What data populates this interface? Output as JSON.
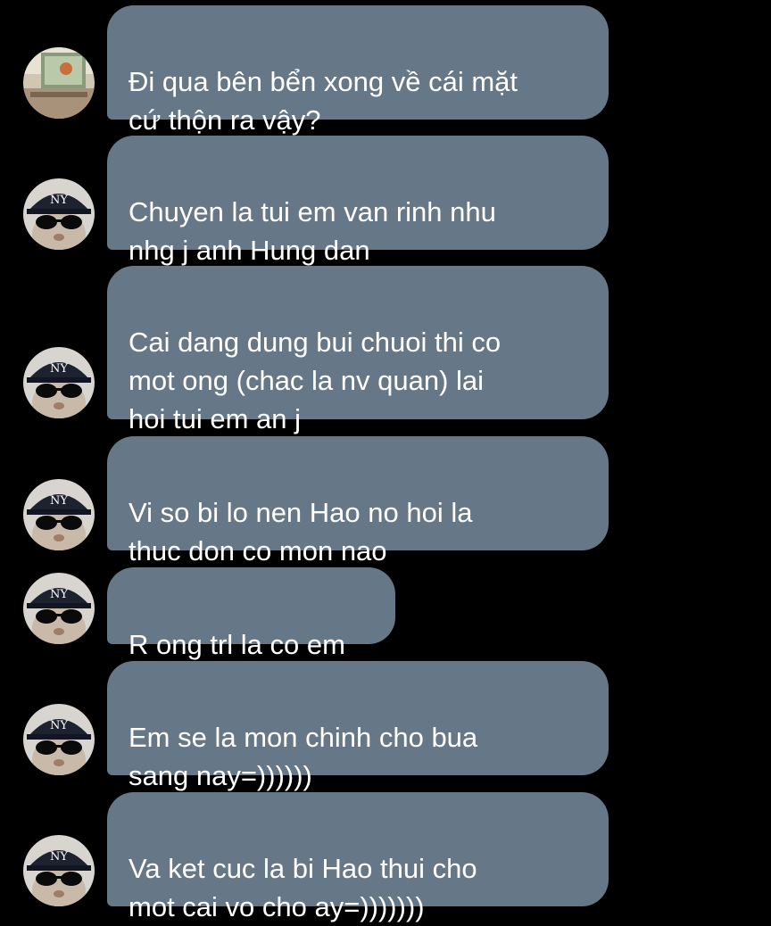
{
  "conversation": {
    "messages": [
      {
        "text": "Đi qua bên bển xong về cái mặt\ncứ thộn ra vậy?",
        "avatar_icon": "home-photo-avatar"
      },
      {
        "text": "Chuyen la tui em van rinh nhu\nnhg j anh Hung dan",
        "avatar_icon": "cat-sunglasses-cap-avatar"
      },
      {
        "text": "Cai dang dung bui chuoi thi co\nmot ong (chac la nv quan) lai\nhoi tui em an j",
        "avatar_icon": "cat-sunglasses-cap-avatar"
      },
      {
        "text": "Vi so bi lo nen Hao no hoi la\nthuc don co mon nao",
        "avatar_icon": "cat-sunglasses-cap-avatar"
      },
      {
        "text": "R ong trl la co em",
        "avatar_icon": "cat-sunglasses-cap-avatar"
      },
      {
        "text": "Em se la mon chinh cho bua\nsang nay=))))))",
        "avatar_icon": "cat-sunglasses-cap-avatar"
      },
      {
        "text": "Va ket cuc la bi Hao thui cho\nmot cai vo cho ay=)))))))",
        "avatar_icon": "cat-sunglasses-cap-avatar"
      }
    ]
  },
  "colors": {
    "background": "#000000",
    "bubble": "#667787",
    "text": "#ffffff"
  }
}
